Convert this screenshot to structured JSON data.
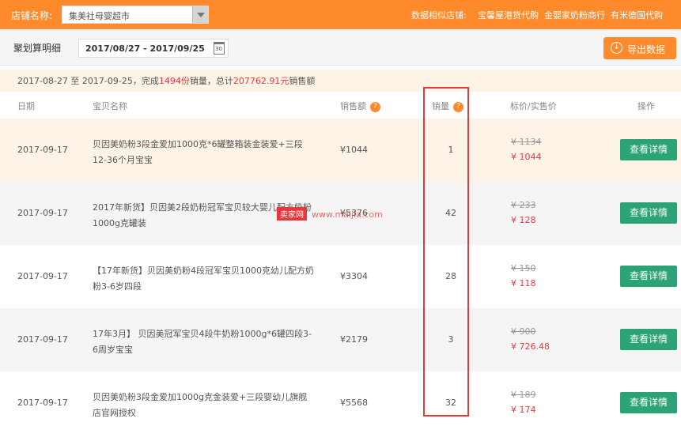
{
  "topbar": {
    "shop_label": "店铺名称:",
    "shop_value": "集美社母婴超市",
    "similar_label": "数据相似店铺:",
    "similar_shops": [
      "宝馨屋港货代购",
      "金婴家奶粉商行",
      "有米德国代购"
    ]
  },
  "toolbar": {
    "title": "聚划算明细",
    "date_range": "2017/08/27 - 2017/09/25",
    "export_label": "导出数据"
  },
  "summary": {
    "prefix": "2017-08-27 至 2017-09-25，完成",
    "count": "1494份",
    "mid": "销量，总计",
    "total": "207762.91元",
    "suffix": "销售额"
  },
  "columns": {
    "date": "日期",
    "name": "宝贝名称",
    "sales": "销售额",
    "qty": "销量",
    "price": "标价/实售价",
    "action": "操作"
  },
  "rows": [
    {
      "date": "2017-09-17",
      "name": "贝因美奶粉3段金爱加1000克*6罐整箱装金装爱+三段12-36个月宝宝",
      "sales": "¥1044",
      "qty": "1",
      "price_orig": "¥ 1134",
      "price_now": "¥ 1044",
      "action": "查看详情"
    },
    {
      "date": "2017-09-17",
      "name": "2017年新货】贝因美2段奶粉冠军宝贝较大婴儿配方奶粉1000g克罐装",
      "sales": "¥5376",
      "qty": "42",
      "price_orig": "¥ 233",
      "price_now": "¥ 128",
      "action": "查看详情"
    },
    {
      "date": "2017-09-17",
      "name": "【17年新货】贝因美奶粉4段冠军宝贝1000克幼儿配方奶粉3-6岁四段",
      "sales": "¥3304",
      "qty": "28",
      "price_orig": "¥ 150",
      "price_now": "¥ 118",
      "action": "查看详情"
    },
    {
      "date": "2017-09-17",
      "name": "17年3月】 贝因美冠军宝贝4段牛奶粉1000g*6罐四段3-6周岁宝宝",
      "sales": "¥2179",
      "qty": "3",
      "price_orig": "¥ 900",
      "price_now": "¥ 726.48",
      "action": "查看详情"
    },
    {
      "date": "2017-09-17",
      "name": "贝因美奶粉3段金爱加1000g克金装爱+三段婴幼儿旗舰店官网授权",
      "sales": "¥5568",
      "qty": "32",
      "price_orig": "¥ 189",
      "price_now": "¥ 174",
      "action": "查看详情"
    }
  ],
  "watermark": {
    "tag": "卖家网",
    "text": "www.maijia.com"
  },
  "colors": {
    "accent": "#ff8a2b",
    "detail_button": "#2aa377",
    "highlight": "#e8383d"
  }
}
